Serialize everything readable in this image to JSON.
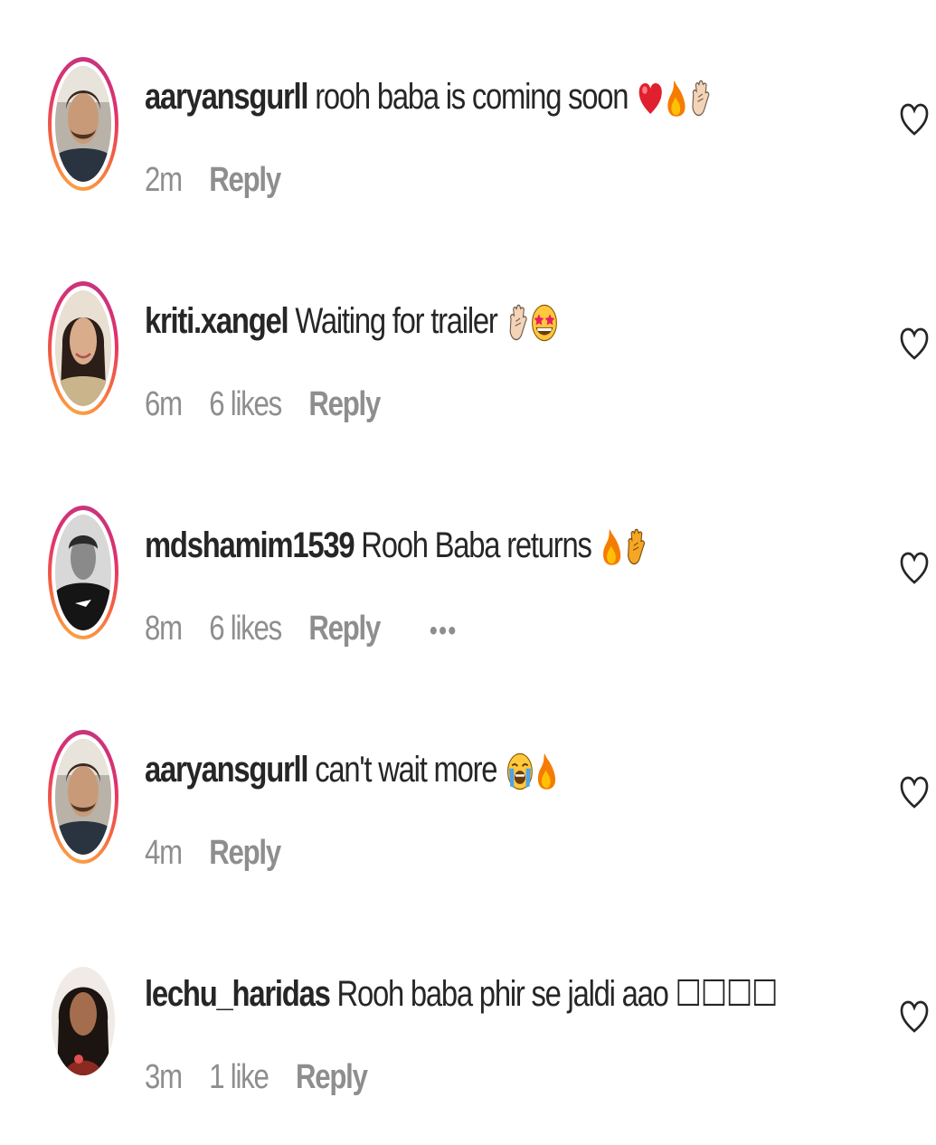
{
  "comments": [
    {
      "username": "aaryansgurll",
      "text": "rooh baba is coming soon",
      "emojis": [
        "red-heart-emoji",
        "fire-emoji",
        "clapping-hand-emoji"
      ],
      "time": "2m",
      "likes": "",
      "reply": "Reply",
      "has_story_ring": true,
      "avatar": "man-smiling-avatar"
    },
    {
      "username": "kriti.xangel",
      "text": "Waiting for trailer",
      "emojis": [
        "clapping-hand-emoji",
        "star-struck-emoji"
      ],
      "time": "6m",
      "likes": "6 likes",
      "reply": "Reply",
      "has_story_ring": true,
      "avatar": "woman-smiling-avatar"
    },
    {
      "username": "mdshamim1539",
      "text": "Rooh Baba returns",
      "emojis": [
        "fire-emoji",
        "clapping-hand-emoji"
      ],
      "time": "8m",
      "likes": "6 likes",
      "reply": "Reply",
      "more": "•••",
      "has_story_ring": true,
      "avatar": "man-bw-avatar"
    },
    {
      "username": "aaryansgurll",
      "text": "can't wait more",
      "emojis": [
        "loudly-crying-emoji",
        "fire-emoji"
      ],
      "time": "4m",
      "likes": "",
      "reply": "Reply",
      "has_story_ring": true,
      "avatar": "man-smiling-avatar"
    },
    {
      "username": "lechu_haridas",
      "text": "Rooh baba phir se jaldi aao ☐☐☐☐",
      "emojis": [],
      "time": "3m",
      "likes": "1 like",
      "reply": "Reply",
      "has_story_ring": false,
      "avatar": "woman-dark-avatar"
    }
  ],
  "colors": {
    "username": "#262626",
    "meta": "#8e8e8e",
    "ring_start": "#c13584",
    "ring_end": "#fcaf45",
    "heart_emoji": "#e0202e",
    "fire_emoji": "#f57c00"
  }
}
